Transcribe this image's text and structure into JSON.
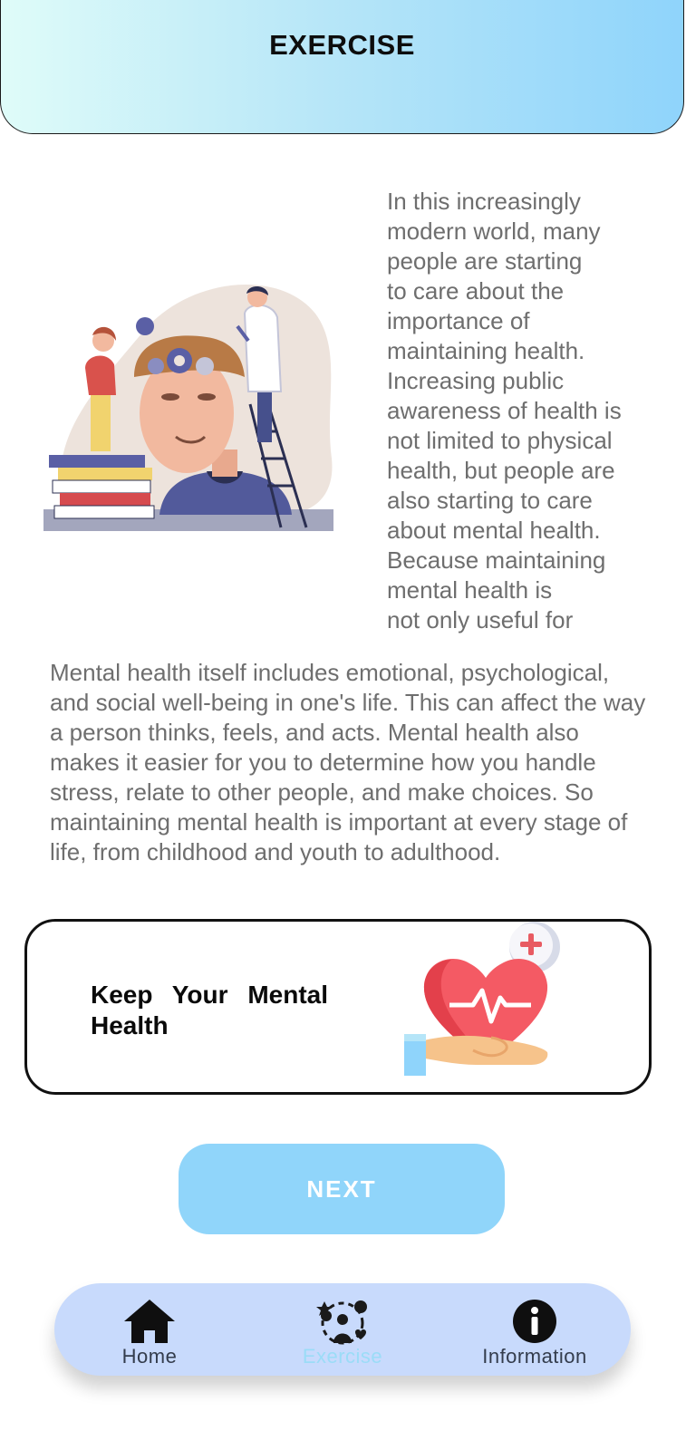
{
  "header": {
    "title": "EXERCISE"
  },
  "intro": {
    "side_text": "In this increasingly\nmodern world, many\npeople are starting\nto care about the\nimportance of\nmaintaining health.\nIncreasing public\nawareness of health is\nnot limited to physical\nhealth, but people are\nalso starting to care\nabout mental health.\nBecause maintaining\nmental health is\nnot only useful for\nyour emotional",
    "body_text": "Mental health itself includes emotional, psychological, and social well-being in one's life. This can affect the way a person thinks, feels, and acts. Mental health also makes it easier for you to determine how you handle stress, relate to other people, and make choices. So maintaining mental health is important at every stage of life, from childhood and youth to adulthood."
  },
  "card": {
    "title": "Keep Your Mental Health",
    "icon": "heart-in-hand-icon"
  },
  "actions": {
    "next_label": "NEXT"
  },
  "bottom_nav": {
    "items": [
      {
        "label": "Home",
        "icon": "home-icon",
        "active": false
      },
      {
        "label": "Exercise",
        "icon": "exercise-icon",
        "active": true
      },
      {
        "label": "Information",
        "icon": "info-icon",
        "active": false
      }
    ],
    "active_color": "#9bdcf7",
    "background": "#c8dafc"
  },
  "colors": {
    "header_gradient_start": "#dffcf9",
    "header_gradient_end": "#8fd4fb",
    "button": "#90d5fa"
  }
}
